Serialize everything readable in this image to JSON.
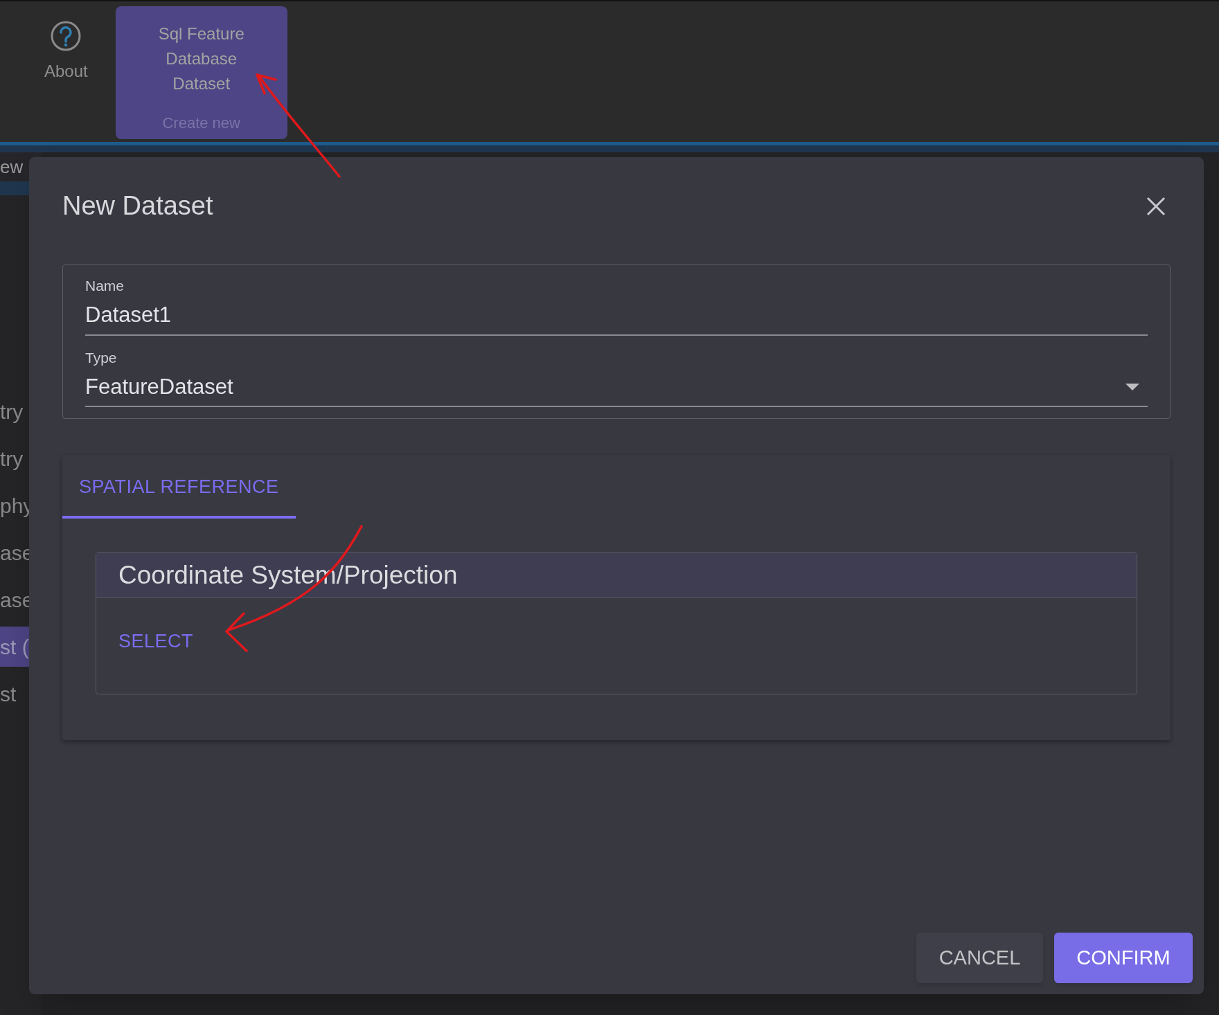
{
  "ribbon": {
    "items": [
      {
        "kind": "icon",
        "label": "About",
        "selected": false
      },
      {
        "kind": "tile",
        "label": "Sql Feature Database Dataset",
        "subtitle": "Create new",
        "selected": true
      }
    ]
  },
  "sidebar": {
    "heading": "ew",
    "items": [
      {
        "label": "try",
        "selected": false
      },
      {
        "label": "try",
        "selected": false
      },
      {
        "label": "phy",
        "selected": false
      },
      {
        "label": "ase",
        "selected": false
      },
      {
        "label": "ase",
        "selected": false
      },
      {
        "label": "st (",
        "selected": true
      },
      {
        "label": "st",
        "selected": false
      }
    ]
  },
  "dialog": {
    "title": "New Dataset",
    "fields": [
      {
        "kind": "text",
        "label": "Name",
        "value": "Dataset1"
      },
      {
        "kind": "select",
        "label": "Type",
        "value": "FeatureDataset"
      }
    ],
    "tabs": [
      {
        "label": "SPATIAL REFERENCE",
        "selected": true
      }
    ],
    "section": {
      "title": "Coordinate System/Projection",
      "action": "SELECT"
    },
    "buttons": [
      {
        "kind": "secondary",
        "label": "CANCEL"
      },
      {
        "kind": "primary",
        "label": "CONFIRM"
      }
    ]
  }
}
